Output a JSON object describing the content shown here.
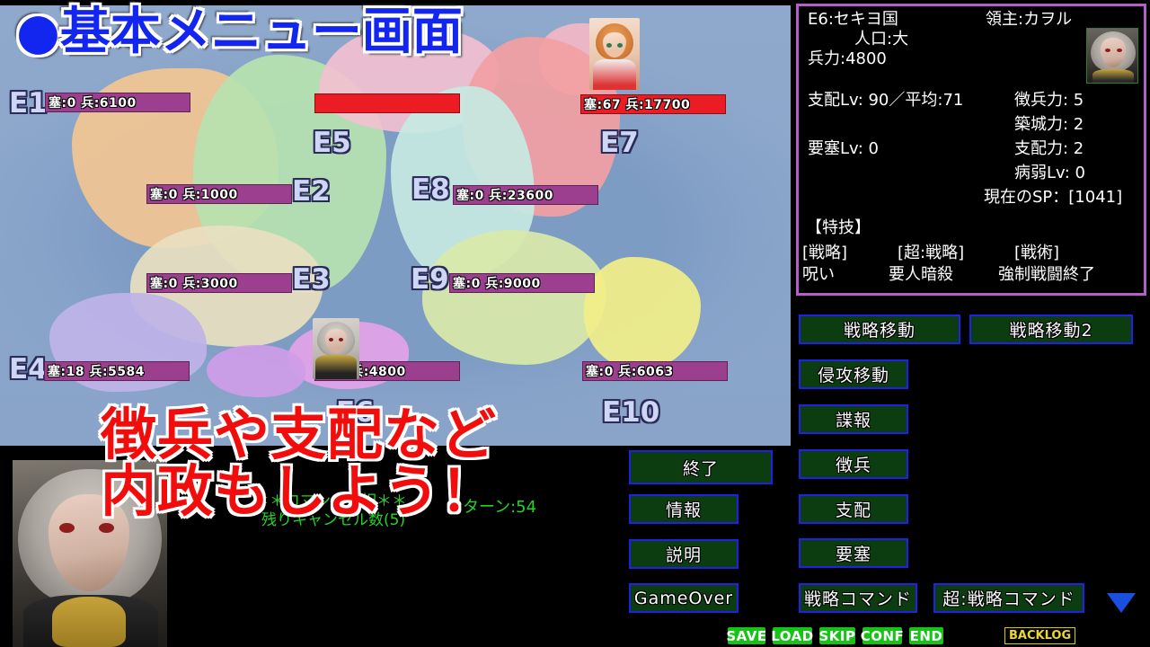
{
  "title_overlay": {
    "bullet": "●",
    "text": "基本メニュー画面"
  },
  "red_caption": {
    "line1": "徴兵や支配など",
    "line2": "内政もしよう！"
  },
  "green_status": {
    "line1": "＊＊コマンド選択＊＊",
    "line2": "残りキャンセル数(5)",
    "turn": "ターン:54"
  },
  "map": {
    "territories": [
      {
        "id": "E1",
        "label": "E1",
        "bar": "塞:0  兵:6100",
        "color": "purple"
      },
      {
        "id": "E2",
        "label": "E2",
        "bar": "塞:0  兵:1000",
        "color": "purple"
      },
      {
        "id": "E3",
        "label": "E3",
        "bar": "塞:0  兵:3000",
        "color": "purple"
      },
      {
        "id": "E4",
        "label": "E4",
        "bar": "塞:18 兵:5584",
        "color": "purple"
      },
      {
        "id": "E5",
        "label": "E5",
        "bar": "",
        "color": "red"
      },
      {
        "id": "E6",
        "label": "E6",
        "bar": "塞:0  兵:4800",
        "color": "purple"
      },
      {
        "id": "E7",
        "label": "E7",
        "bar": "塞:67 兵:17700",
        "color": "red"
      },
      {
        "id": "E8",
        "label": "E8",
        "bar": "塞:0  兵:23600",
        "color": "purple"
      },
      {
        "id": "E9",
        "label": "E9",
        "bar": "塞:0  兵:9000",
        "color": "purple"
      },
      {
        "id": "E10",
        "label": "E10",
        "bar": "塞:0  兵:6063",
        "color": "purple"
      }
    ]
  },
  "info_panel": {
    "territory_name": "E6:セキヨ国",
    "lord": "領主:カヲル",
    "population": "人口:大",
    "military": "兵力:4800",
    "rule_level": "支配Lv: 90／平均:71",
    "fort_level": "要塞Lv: 0",
    "conscription_power": "徴兵力: 5",
    "castle_power": "築城力: 2",
    "rule_power": "支配力: 2",
    "sickness_level": "病弱Lv: 0",
    "current_sp": "現在のSP：[1041]",
    "skills_title": "【特技】",
    "skill_headers": [
      "[戦略]",
      "[超:戦略]",
      "[戦術]"
    ],
    "skill_values": [
      "呪い",
      "要人暗殺",
      "強制戦闘終了"
    ],
    "border_color": "#b45ec8"
  },
  "left_menu": [
    {
      "name": "exit",
      "label": "終了"
    },
    {
      "name": "info",
      "label": "情報"
    },
    {
      "name": "help",
      "label": "説明"
    },
    {
      "name": "gameover",
      "label": "GameOver"
    }
  ],
  "right_menu": [
    {
      "name": "strategic-move",
      "label": "戦略移動"
    },
    {
      "name": "strategic-move-2",
      "label": "戦略移動2"
    },
    {
      "name": "invasion-move",
      "label": "侵攻移動"
    },
    {
      "name": "espionage",
      "label": "諜報"
    },
    {
      "name": "conscription",
      "label": "徴兵"
    },
    {
      "name": "rule",
      "label": "支配"
    },
    {
      "name": "fortress",
      "label": "要塞"
    },
    {
      "name": "strategy-command",
      "label": "戦略コマンド"
    },
    {
      "name": "super-strategy-command",
      "label": "超:戦略コマンド"
    }
  ],
  "status_bar": {
    "buttons": [
      "SAVE",
      "LOAD",
      "SKIP",
      "CONF",
      "END"
    ],
    "backlog": "BACKLOG",
    "button_color": "#18c318",
    "backlog_color": "#ead92a"
  }
}
